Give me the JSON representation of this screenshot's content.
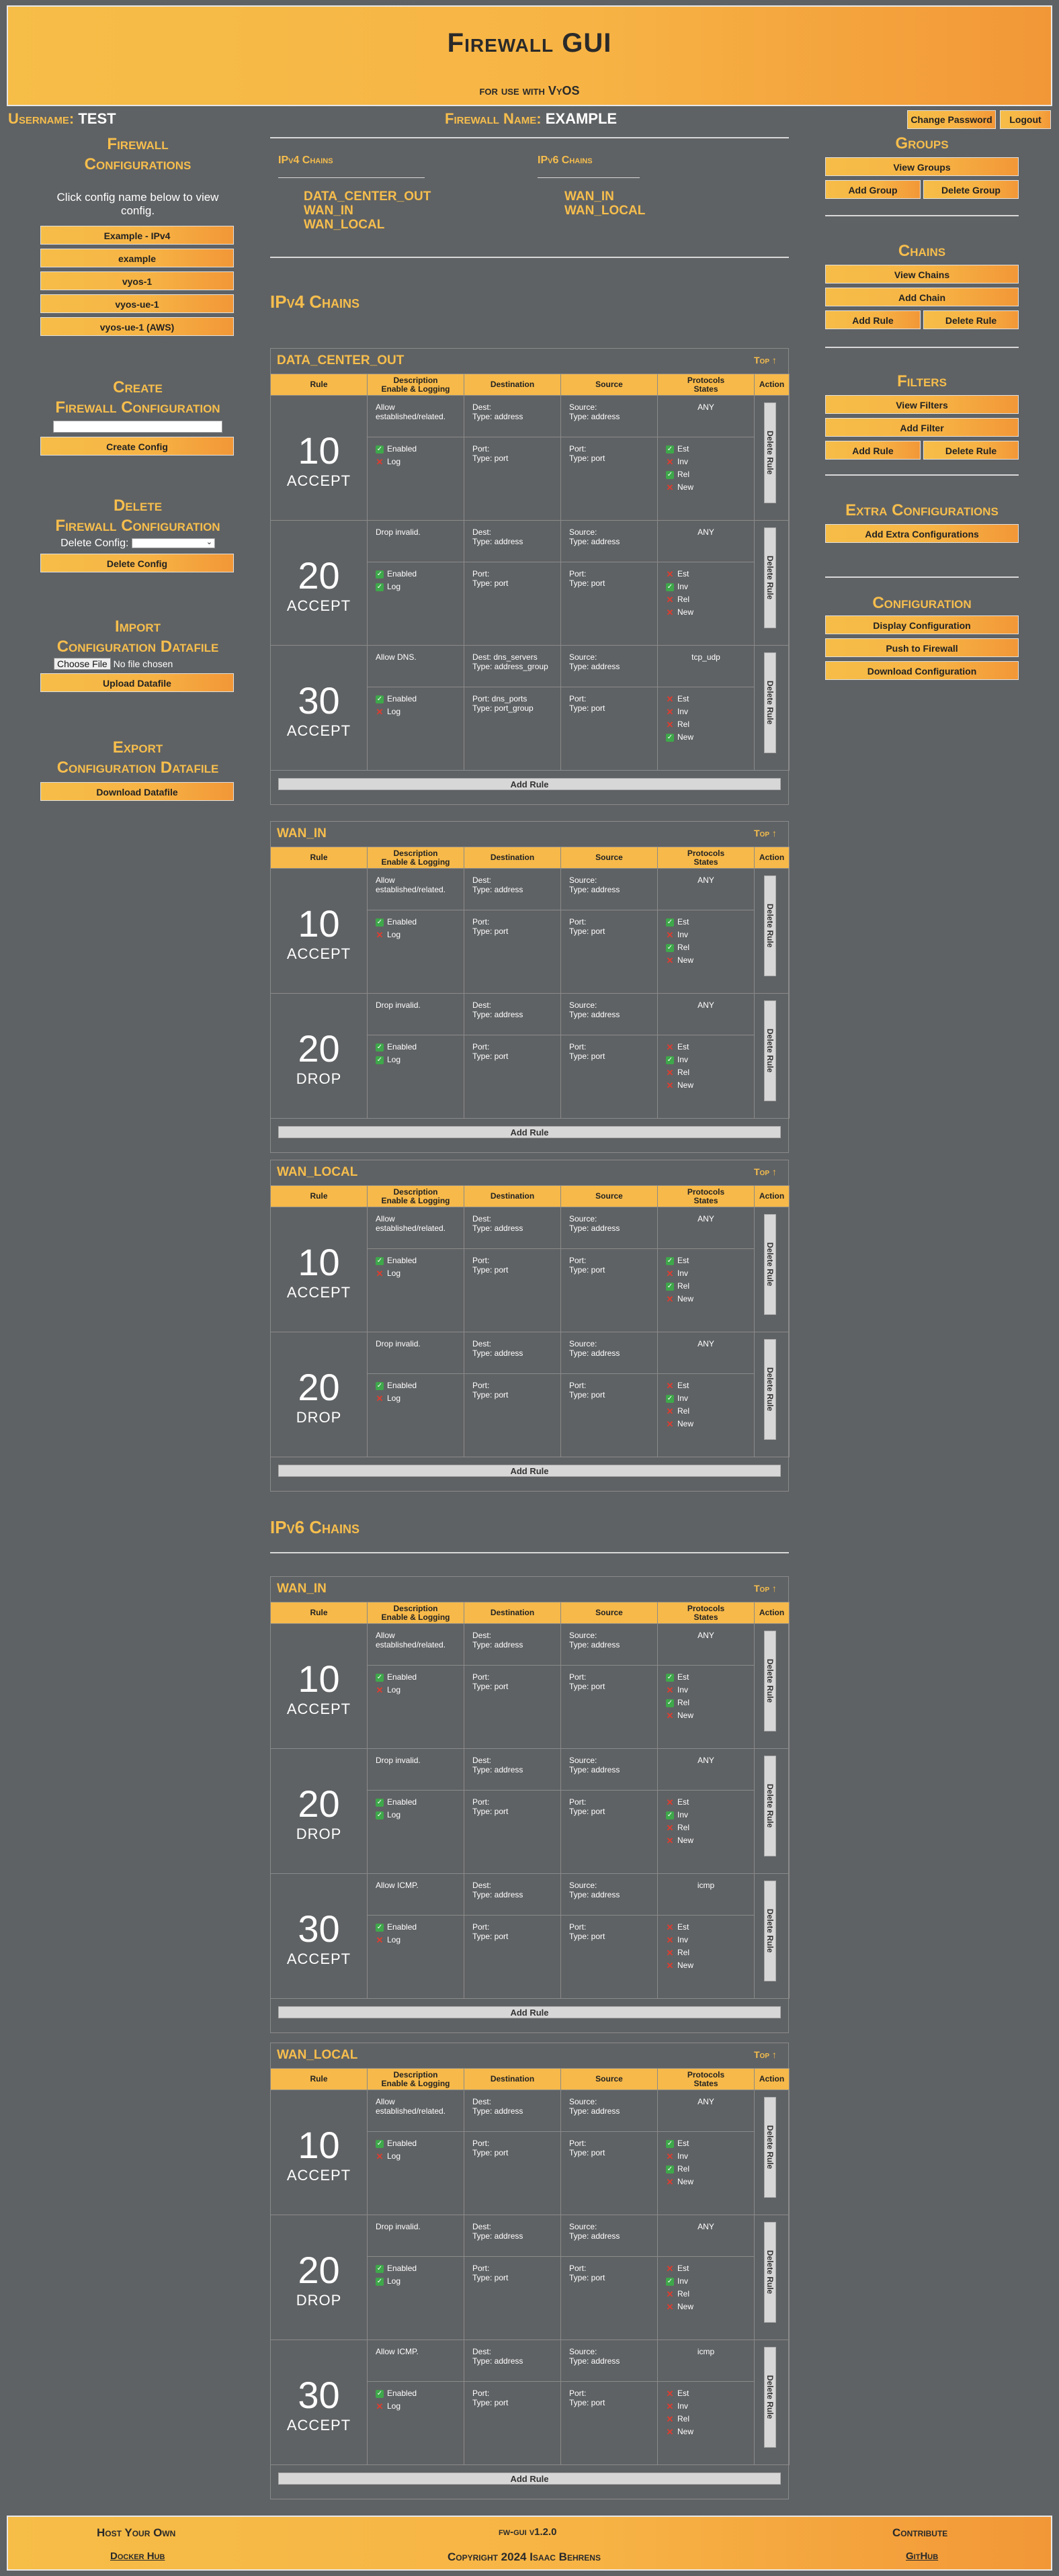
{
  "header": {
    "title": "Firewall GUI",
    "subtitle": "for use with VyOS"
  },
  "user": {
    "label": "Username:",
    "name": "TEST"
  },
  "firewall": {
    "label": "Firewall Name:",
    "name": "EXAMPLE"
  },
  "topbar": {
    "change_password": "Change Password",
    "logout": "Logout"
  },
  "left": {
    "configs_title_1": "Firewall",
    "configs_title_2": "Configurations",
    "configs_note": "Click config name below to view config.",
    "configs": [
      "Example - IPv4",
      "example",
      "vyos-1",
      "vyos-ue-1",
      "vyos-ue-1 (AWS)"
    ],
    "create_title_1": "Create",
    "create_title_2": "Firewall Configuration",
    "create_button": "Create Config",
    "delete_title_1": "Delete",
    "delete_title_2": "Firewall Configuration",
    "delete_label": "Delete Config:",
    "delete_button": "Delete Config",
    "import_title_1": "Import",
    "import_title_2": "Configuration Datafile",
    "choose_file": "Choose File",
    "no_file": "No file chosen",
    "upload_button": "Upload Datafile",
    "export_title_1": "Export",
    "export_title_2": "Configuration Datafile",
    "download_button": "Download Datafile"
  },
  "right": {
    "groups_title": "Groups",
    "view_groups": "View Groups",
    "add_group": "Add Group",
    "delete_group": "Delete Group",
    "chains_title": "Chains",
    "view_chains": "View Chains",
    "add_chain": "Add Chain",
    "add_rule": "Add Rule",
    "delete_rule": "Delete Rule",
    "filters_title": "Filters",
    "view_filters": "View Filters",
    "add_filter": "Add Filter",
    "add_rule2": "Add Rule",
    "delete_rule2": "Delete Rule",
    "extra_title": "Extra Configurations",
    "add_extra": "Add Extra Configurations",
    "config_title": "Configuration",
    "display_config": "Display Configuration",
    "push_fw": "Push to Firewall",
    "download_config": "Download Configuration"
  },
  "index": {
    "ipv4_head": "IPv4 Chains",
    "ipv6_head": "IPv6 Chains",
    "ipv4": [
      "DATA_CENTER_OUT",
      "WAN_IN",
      "WAN_LOCAL"
    ],
    "ipv6": [
      "WAN_IN",
      "WAN_LOCAL"
    ]
  },
  "sections": {
    "ipv4": "IPv4 Chains",
    "ipv6": "IPv6 Chains"
  },
  "columns": [
    "Rule",
    "Description",
    "Enable & Logging",
    "Destination",
    "Source",
    "Protocols",
    "States",
    "Action"
  ],
  "misc": {
    "top": "Top",
    "add_rule": "Add Rule",
    "delete_rule": "Delete Rule",
    "enabled": "Enabled",
    "log": "Log",
    "port": "Port:",
    "type_port": "Type: port"
  },
  "chains": [
    {
      "name": "DATA_CENTER_OUT",
      "rules": [
        {
          "num": "10",
          "action": "ACCEPT",
          "desc": "Allow established/related.",
          "enabled": true,
          "log": false,
          "dest": "Dest:",
          "dest_type": "Type: address",
          "dport": "Port:",
          "dport_type": "Type: port",
          "src": "Source:",
          "src_type": "Type: address",
          "sport": "Port:",
          "sport_type": "Type: port",
          "proto": "ANY",
          "states": [
            true,
            false,
            true,
            false
          ]
        },
        {
          "num": "20",
          "action": "ACCEPT",
          "desc": "Drop invalid.",
          "enabled": true,
          "log": true,
          "dest": "Dest:",
          "dest_type": "Type: address",
          "dport": "Port:",
          "dport_type": "Type: port",
          "src": "Source:",
          "src_type": "Type: address",
          "sport": "Port:",
          "sport_type": "Type: port",
          "proto": "ANY",
          "states": [
            false,
            true,
            false,
            false
          ]
        },
        {
          "num": "30",
          "action": "ACCEPT",
          "desc": "Allow DNS.",
          "enabled": true,
          "log": false,
          "dest": "Dest: dns_servers",
          "dest_type": "Type: address_group",
          "dport": "Port: dns_ports",
          "dport_type": "Type: port_group",
          "src": "Source:",
          "src_type": "Type: address",
          "sport": "Port:",
          "sport_type": "Type: port",
          "proto": "tcp_udp",
          "states": [
            false,
            false,
            false,
            true
          ]
        }
      ]
    },
    {
      "name": "WAN_IN",
      "rules": [
        {
          "num": "10",
          "action": "ACCEPT",
          "desc": "Allow established/related.",
          "enabled": true,
          "log": false,
          "dest": "Dest:",
          "dest_type": "Type: address",
          "dport": "Port:",
          "dport_type": "Type: port",
          "src": "Source:",
          "src_type": "Type: address",
          "sport": "Port:",
          "sport_type": "Type: port",
          "proto": "ANY",
          "states": [
            true,
            false,
            true,
            false
          ]
        },
        {
          "num": "20",
          "action": "DROP",
          "desc": "Drop invalid.",
          "enabled": true,
          "log": true,
          "dest": "Dest:",
          "dest_type": "Type: address",
          "dport": "Port:",
          "dport_type": "Type: port",
          "src": "Source:",
          "src_type": "Type: address",
          "sport": "Port:",
          "sport_type": "Type: port",
          "proto": "ANY",
          "states": [
            false,
            true,
            false,
            false
          ]
        }
      ]
    },
    {
      "name": "WAN_LOCAL",
      "rules": [
        {
          "num": "10",
          "action": "ACCEPT",
          "desc": "Allow established/related.",
          "enabled": true,
          "log": false,
          "dest": "Dest:",
          "dest_type": "Type: address",
          "dport": "Port:",
          "dport_type": "Type: port",
          "src": "Source:",
          "src_type": "Type: address",
          "sport": "Port:",
          "sport_type": "Type: port",
          "proto": "ANY",
          "states": [
            true,
            false,
            true,
            false
          ]
        },
        {
          "num": "20",
          "action": "DROP",
          "desc": "Drop invalid.",
          "enabled": true,
          "log": false,
          "dest": "Dest:",
          "dest_type": "Type: address",
          "dport": "Port:",
          "dport_type": "Type: port",
          "src": "Source:",
          "src_type": "Type: address",
          "sport": "Port:",
          "sport_type": "Type: port",
          "proto": "ANY",
          "states": [
            false,
            true,
            false,
            false
          ]
        }
      ]
    },
    {
      "name": "WAN_IN",
      "rules": [
        {
          "num": "10",
          "action": "ACCEPT",
          "desc": "Allow established/related.",
          "enabled": true,
          "log": false,
          "dest": "Dest:",
          "dest_type": "Type: address",
          "dport": "Port:",
          "dport_type": "Type: port",
          "src": "Source:",
          "src_type": "Type: address",
          "sport": "Port:",
          "sport_type": "Type: port",
          "proto": "ANY",
          "states": [
            true,
            false,
            true,
            false
          ]
        },
        {
          "num": "20",
          "action": "DROP",
          "desc": "Drop invalid.",
          "enabled": true,
          "log": true,
          "dest": "Dest:",
          "dest_type": "Type: address",
          "dport": "Port:",
          "dport_type": "Type: port",
          "src": "Source:",
          "src_type": "Type: address",
          "sport": "Port:",
          "sport_type": "Type: port",
          "proto": "ANY",
          "states": [
            false,
            true,
            false,
            false
          ]
        },
        {
          "num": "30",
          "action": "ACCEPT",
          "desc": "Allow ICMP.",
          "enabled": true,
          "log": false,
          "dest": "Dest:",
          "dest_type": "Type: address",
          "dport": "Port:",
          "dport_type": "Type: port",
          "src": "Source:",
          "src_type": "Type: address",
          "sport": "Port:",
          "sport_type": "Type: port",
          "proto": "icmp",
          "states": [
            false,
            false,
            false,
            false
          ]
        }
      ]
    },
    {
      "name": "WAN_LOCAL",
      "rules": [
        {
          "num": "10",
          "action": "ACCEPT",
          "desc": "Allow established/related.",
          "enabled": true,
          "log": false,
          "dest": "Dest:",
          "dest_type": "Type: address",
          "dport": "Port:",
          "dport_type": "Type: port",
          "src": "Source:",
          "src_type": "Type: address",
          "sport": "Port:",
          "sport_type": "Type: port",
          "proto": "ANY",
          "states": [
            true,
            false,
            true,
            false
          ]
        },
        {
          "num": "20",
          "action": "DROP",
          "desc": "Drop invalid.",
          "enabled": true,
          "log": true,
          "dest": "Dest:",
          "dest_type": "Type: address",
          "dport": "Port:",
          "dport_type": "Type: port",
          "src": "Source:",
          "src_type": "Type: address",
          "sport": "Port:",
          "sport_type": "Type: port",
          "proto": "ANY",
          "states": [
            false,
            true,
            false,
            false
          ]
        },
        {
          "num": "30",
          "action": "ACCEPT",
          "desc": "Allow ICMP.",
          "enabled": true,
          "log": false,
          "dest": "Dest:",
          "dest_type": "Type: address",
          "dport": "Port:",
          "dport_type": "Type: port",
          "src": "Source:",
          "src_type": "Type: address",
          "sport": "Port:",
          "sport_type": "Type: port",
          "proto": "icmp",
          "states": [
            false,
            false,
            false,
            false
          ]
        }
      ]
    }
  ],
  "state_labels": [
    "Est",
    "Inv",
    "Rel",
    "New"
  ],
  "footer": {
    "host": "Host Your Own",
    "docker": "Docker Hub",
    "version": "fw-gui v1.2.0",
    "copyright": "Copyright 2024 Isaac Behrens",
    "contribute": "Contribute",
    "github": "GitHub"
  },
  "colors": {
    "accent": "#f7be4d",
    "background": "#5f6264",
    "check": "#3ea84a",
    "cross": "#e03b2e"
  }
}
